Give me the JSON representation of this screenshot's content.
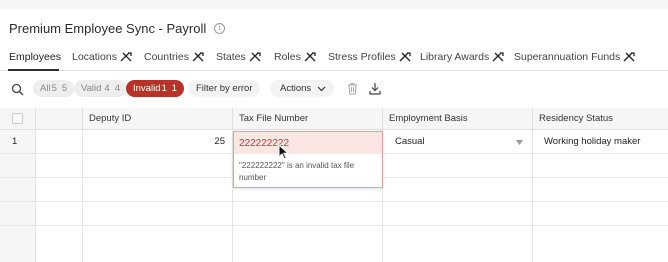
{
  "page": {
    "title": "Premium Employee Sync - Payroll"
  },
  "tabs": [
    {
      "label": "Employees",
      "active": true,
      "sync_disabled": false
    },
    {
      "label": "Locations",
      "active": false,
      "sync_disabled": true
    },
    {
      "label": "Countries",
      "active": false,
      "sync_disabled": true
    },
    {
      "label": "States",
      "active": false,
      "sync_disabled": true
    },
    {
      "label": "Roles",
      "active": false,
      "sync_disabled": true
    },
    {
      "label": "Stress Profiles",
      "active": false,
      "sync_disabled": true
    },
    {
      "label": "Library Awards",
      "active": false,
      "sync_disabled": true
    },
    {
      "label": "Superannuation Funds",
      "active": false,
      "sync_disabled": true
    }
  ],
  "toolbar": {
    "filters": {
      "all": {
        "label": "All",
        "count_a": "5",
        "count_b": "5"
      },
      "valid": {
        "label": "Valid",
        "count_a": "4",
        "count_b": "4"
      },
      "invalid": {
        "label": "Invalid",
        "count_a": "1",
        "count_b": "1"
      }
    },
    "filter_by_error_label": "Filter by error",
    "actions_label": "Actions",
    "icons": [
      "search-icon",
      "trash-icon",
      "download-icon",
      "chevron-down-icon"
    ]
  },
  "grid": {
    "columns": [
      "Deputy ID",
      "Tax File Number",
      "Employment Basis",
      "Residency Status"
    ],
    "rows": [
      {
        "row_number": "1",
        "deputy_id": "25",
        "tax_file_number": "222222222",
        "employment_basis": "Casual",
        "residency_status": "Working holiday maker"
      }
    ],
    "error": {
      "message": "\"222222222\" is an invalid tax file number"
    }
  },
  "colors": {
    "invalid_badge": "#b8322a",
    "error_text": "#c43a30",
    "error_bg": "#fbe6e4"
  }
}
